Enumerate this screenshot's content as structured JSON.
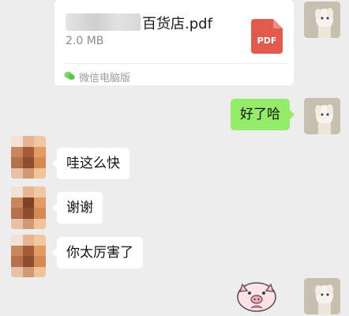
{
  "file_message": {
    "filename_visible": "百货店.pdf",
    "size": "2.0 MB",
    "icon_label": "PDF",
    "source_label": "微信电脑版"
  },
  "messages": [
    {
      "side": "right",
      "text": "好了哈"
    },
    {
      "side": "left",
      "text": "哇这么快"
    },
    {
      "side": "left",
      "text": "谢谢"
    },
    {
      "side": "left",
      "text": "你太厉害了"
    }
  ],
  "sticker": {
    "name": "pig-sticker"
  },
  "colors": {
    "background": "#ededed",
    "bubble_self": "#95ec69",
    "bubble_other": "#ffffff",
    "pdf_red": "#e25a4c"
  }
}
